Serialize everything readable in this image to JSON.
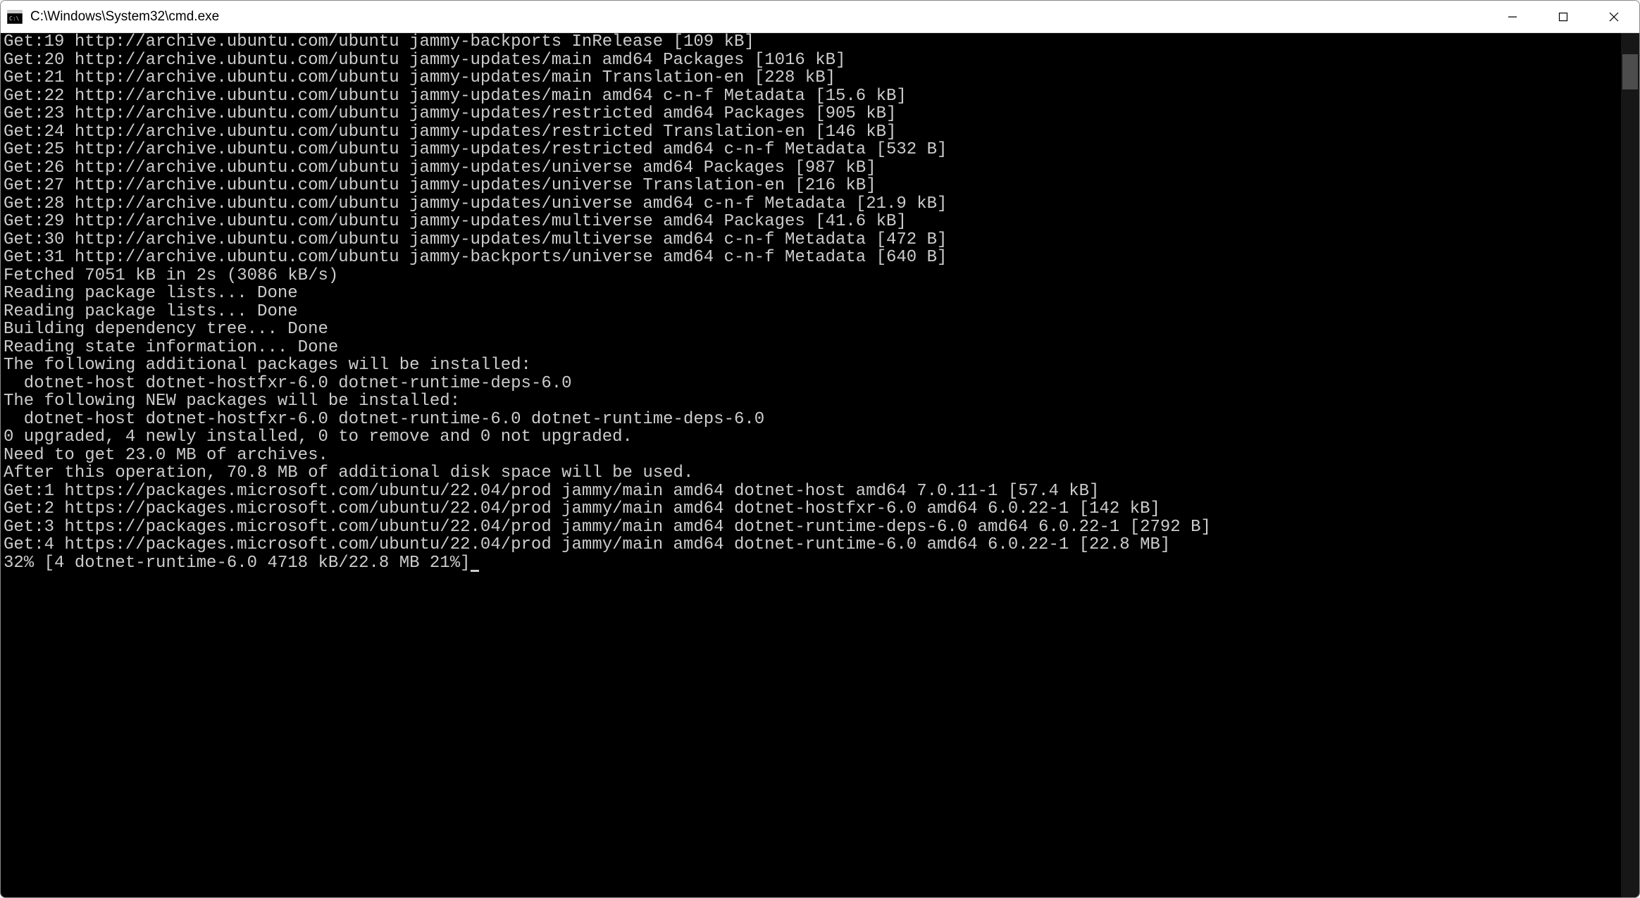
{
  "window": {
    "title": "C:\\Windows\\System32\\cmd.exe"
  },
  "terminal": {
    "lines": [
      "Get:19 http://archive.ubuntu.com/ubuntu jammy-backports InRelease [109 kB]",
      "Get:20 http://archive.ubuntu.com/ubuntu jammy-updates/main amd64 Packages [1016 kB]",
      "Get:21 http://archive.ubuntu.com/ubuntu jammy-updates/main Translation-en [228 kB]",
      "Get:22 http://archive.ubuntu.com/ubuntu jammy-updates/main amd64 c-n-f Metadata [15.6 kB]",
      "Get:23 http://archive.ubuntu.com/ubuntu jammy-updates/restricted amd64 Packages [905 kB]",
      "Get:24 http://archive.ubuntu.com/ubuntu jammy-updates/restricted Translation-en [146 kB]",
      "Get:25 http://archive.ubuntu.com/ubuntu jammy-updates/restricted amd64 c-n-f Metadata [532 B]",
      "Get:26 http://archive.ubuntu.com/ubuntu jammy-updates/universe amd64 Packages [987 kB]",
      "Get:27 http://archive.ubuntu.com/ubuntu jammy-updates/universe Translation-en [216 kB]",
      "Get:28 http://archive.ubuntu.com/ubuntu jammy-updates/universe amd64 c-n-f Metadata [21.9 kB]",
      "Get:29 http://archive.ubuntu.com/ubuntu jammy-updates/multiverse amd64 Packages [41.6 kB]",
      "Get:30 http://archive.ubuntu.com/ubuntu jammy-updates/multiverse amd64 c-n-f Metadata [472 B]",
      "Get:31 http://archive.ubuntu.com/ubuntu jammy-backports/universe amd64 c-n-f Metadata [640 B]",
      "Fetched 7051 kB in 2s (3086 kB/s)",
      "Reading package lists... Done",
      "Reading package lists... Done",
      "Building dependency tree... Done",
      "Reading state information... Done",
      "The following additional packages will be installed:",
      "  dotnet-host dotnet-hostfxr-6.0 dotnet-runtime-deps-6.0",
      "The following NEW packages will be installed:",
      "  dotnet-host dotnet-hostfxr-6.0 dotnet-runtime-6.0 dotnet-runtime-deps-6.0",
      "0 upgraded, 4 newly installed, 0 to remove and 0 not upgraded.",
      "Need to get 23.0 MB of archives.",
      "After this operation, 70.8 MB of additional disk space will be used.",
      "Get:1 https://packages.microsoft.com/ubuntu/22.04/prod jammy/main amd64 dotnet-host amd64 7.0.11-1 [57.4 kB]",
      "Get:2 https://packages.microsoft.com/ubuntu/22.04/prod jammy/main amd64 dotnet-hostfxr-6.0 amd64 6.0.22-1 [142 kB]",
      "Get:3 https://packages.microsoft.com/ubuntu/22.04/prod jammy/main amd64 dotnet-runtime-deps-6.0 amd64 6.0.22-1 [2792 B]",
      "Get:4 https://packages.microsoft.com/ubuntu/22.04/prod jammy/main amd64 dotnet-runtime-6.0 amd64 6.0.22-1 [22.8 MB]",
      "32% [4 dotnet-runtime-6.0 4718 kB/22.8 MB 21%]"
    ]
  }
}
